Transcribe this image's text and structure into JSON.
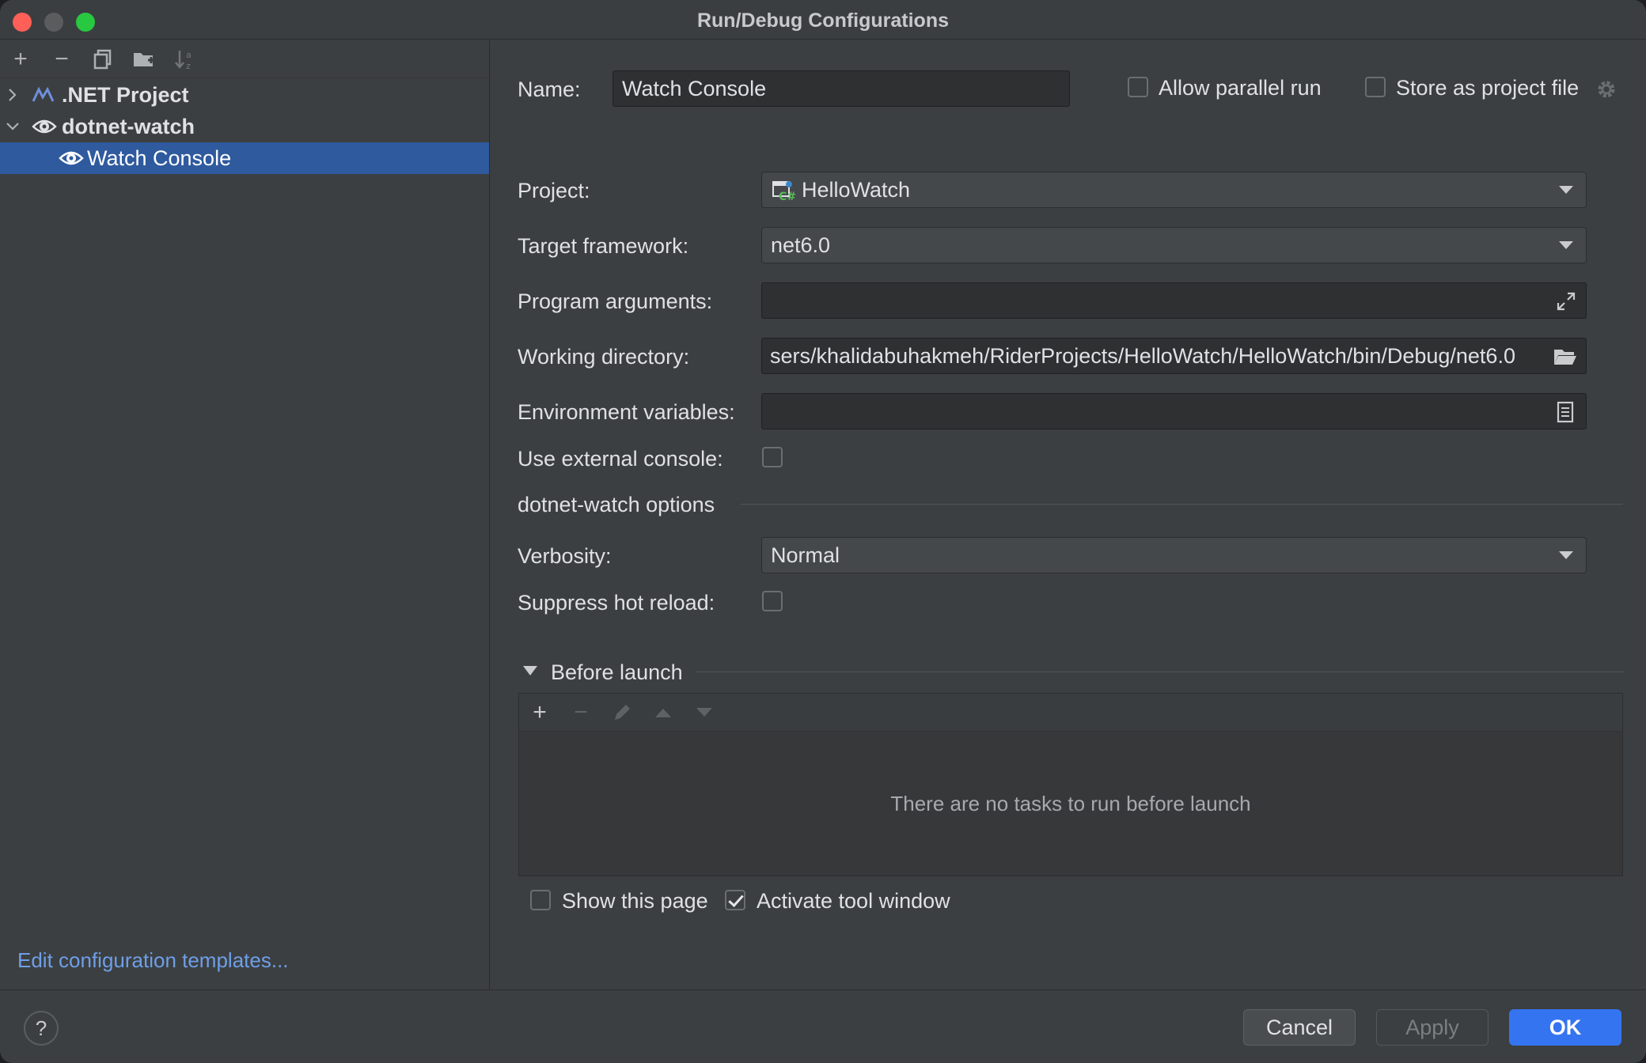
{
  "window": {
    "title": "Run/Debug Configurations"
  },
  "left_toolbar": {
    "add": "+",
    "remove": "−"
  },
  "tree": {
    "items": [
      {
        "label": ".NET Project"
      },
      {
        "label": "dotnet-watch"
      },
      {
        "label": "Watch Console"
      }
    ]
  },
  "edit_templates": "Edit configuration templates...",
  "form": {
    "name_label": "Name:",
    "name_value": "Watch Console",
    "allow_parallel": "Allow parallel run",
    "store_project": "Store as project file",
    "project_label": "Project:",
    "project_value": "HelloWatch",
    "framework_label": "Target framework:",
    "framework_value": "net6.0",
    "args_label": "Program arguments:",
    "args_value": "",
    "workdir_label": "Working directory:",
    "workdir_value": "sers/khalidabuhakmeh/RiderProjects/HelloWatch/HelloWatch/bin/Debug/net6.0",
    "env_label": "Environment variables:",
    "env_value": "",
    "ext_console_label": "Use external console:",
    "watch_section": "dotnet-watch options",
    "verbosity_label": "Verbosity:",
    "verbosity_value": "Normal",
    "suppress_label": "Suppress hot reload:"
  },
  "before_launch": {
    "title": "Before launch",
    "add": "+",
    "remove": "−",
    "empty_text": "There are no tasks to run before launch",
    "show_page": "Show this page",
    "activate_tool": "Activate tool window"
  },
  "checkboxes": {
    "allow_parallel": false,
    "store_project": false,
    "ext_console": false,
    "suppress_reload": false,
    "show_page": false,
    "activate_tool": true
  },
  "buttons": {
    "help": "?",
    "cancel": "Cancel",
    "apply": "Apply",
    "ok": "OK"
  },
  "colors": {
    "accent": "#3574f0",
    "selection": "#2f5a9e",
    "link": "#6e9fe8",
    "close": "#fe5f57",
    "maximize": "#28c840"
  }
}
